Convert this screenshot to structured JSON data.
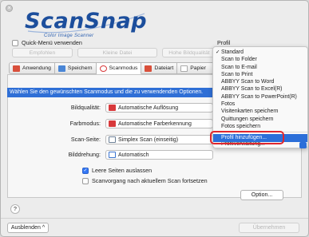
{
  "window": {
    "close_glyph": "×"
  },
  "logo": {
    "main": "ScanSnap",
    "sub": "Color Image Scanner"
  },
  "quick_menu": {
    "label": "Quick-Menü verwenden",
    "checked": false
  },
  "profile": {
    "label": "Profil"
  },
  "quality_buttons": [
    "Empfohlen",
    "Kleine Datei",
    "Hohe Bildqualität"
  ],
  "tabs": [
    {
      "label": "Anwendung",
      "icon": "app-icon",
      "color": "#d9503c"
    },
    {
      "label": "Speichern",
      "icon": "save-icon",
      "color": "#4a86d6"
    },
    {
      "label": "Scanmodus",
      "icon": "scanmode-icon",
      "color": "#d8393b"
    },
    {
      "label": "Dateiart",
      "icon": "filetype-icon",
      "color": "#d94f3a"
    },
    {
      "label": "Papier",
      "icon": "paper-icon",
      "color": "#c9c9c9"
    }
  ],
  "banner": {
    "text": "Wählen Sie den gewünschten Scanmodus und die zu verwendenden Optionen."
  },
  "fields": {
    "bildqualitaet": {
      "label": "Bildqualität:",
      "value": "Automatische Auflösung",
      "icon_color": "#d8393b"
    },
    "farbmodus": {
      "label": "Farbmodus:",
      "value": "Automatische Farberkennung",
      "icon_color": "#d8393b"
    },
    "scanseite": {
      "label": "Scan-Seite:",
      "value": "Simplex Scan (einseitig)",
      "icon_color": "#6b7f95"
    },
    "bilddrehung": {
      "label": "Bilddrehung:",
      "value": "Automatisch",
      "icon_color": "#3b74cf"
    }
  },
  "checkboxes": {
    "leere_seiten": {
      "label": "Leere Seiten auslassen",
      "checked": true
    },
    "scanvorgang": {
      "label": "Scanvorgang nach aktuellem Scan fortsetzen",
      "checked": false
    }
  },
  "buttons": {
    "option": "Option...",
    "help": "?",
    "hide": "Ausblenden",
    "hide_chevron": "^",
    "apply": "Übernehmen"
  },
  "dropdown": {
    "check_glyph": "✓",
    "items": [
      "Standard",
      "Scan to Folder",
      "Scan to E-mail",
      "Scan to Print",
      "ABBYY Scan to Word",
      "ABBYY Scan to Excel(R)",
      "ABBYY Scan to PowerPoint(R)",
      "Fotos",
      "Visitenkarten speichern",
      "Quittungen speichern",
      "Fotos speichern"
    ],
    "selected_item": "Profil hinzufügen...",
    "partial_item": "Profilverwaltung..."
  },
  "colors": {
    "accent": "#2c6fd9",
    "highlight_ring": "#e0262d",
    "logo": "#1c4e9c"
  }
}
